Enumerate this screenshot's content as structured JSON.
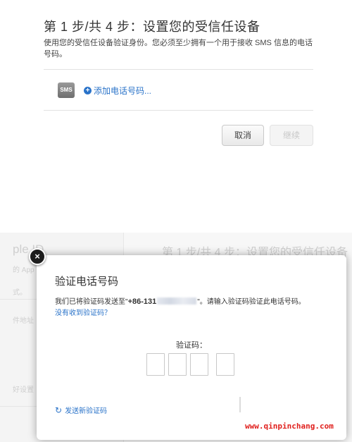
{
  "top": {
    "title": "第 1 步/共 4 步：设置您的受信任设备",
    "description": "使用您的受信任设备验证身份。您必须至少拥有一个用于接收 SMS 信息的电话号码。",
    "sms_badge": "SMS",
    "add_phone_label": "添加电话号码...",
    "add_icon": "+",
    "cancel_label": "取消",
    "continue_label": "继续"
  },
  "background": {
    "apple_id": "ple ID",
    "line1": "的 App",
    "line2": "式。",
    "line3": "件地址",
    "line4": "好设置",
    "title": "第 1 步/共 4 步：设置您的受信任设备"
  },
  "modal": {
    "title": "验证电话号码",
    "text_prefix": "我们已将验证码发送至\"",
    "phone_prefix": "+86-131",
    "text_suffix": "\"。请输入验证码验证此电话号码。",
    "no_code_link": "没有收到验证码？",
    "code_label": "验证码：",
    "code_boxes": [
      "",
      "",
      "",
      ""
    ],
    "resend_label": "发送新验证码",
    "close_icon": "×",
    "refresh_icon": "↻"
  },
  "watermark": "www.qinpinchang.com"
}
